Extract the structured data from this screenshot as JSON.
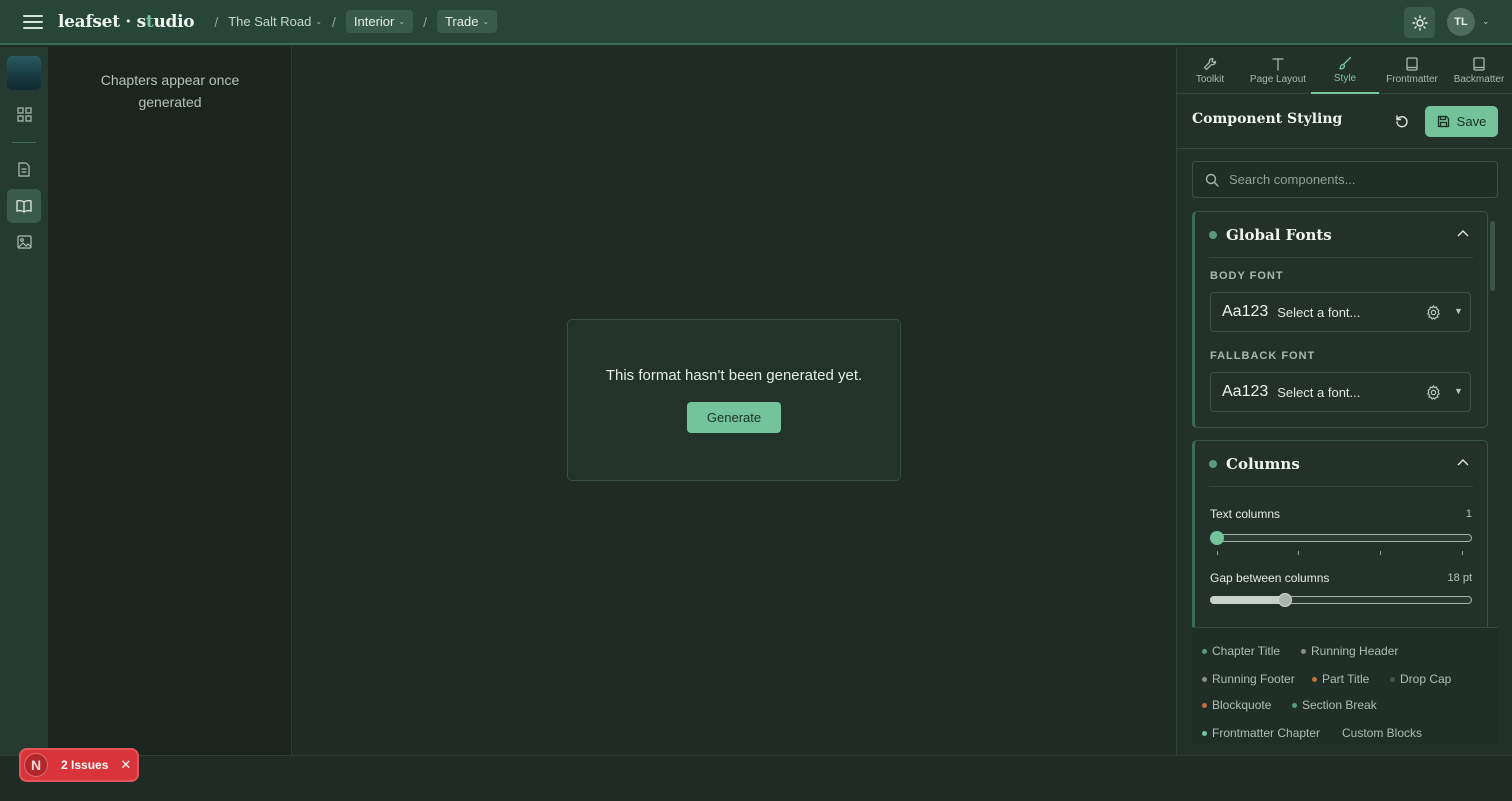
{
  "app": {
    "logo_main": "leafset",
    "logo_mid": "·",
    "logo_s": "s",
    "logo_t": "t",
    "logo_rest": "udio"
  },
  "breadcrumb": {
    "separator": "/",
    "project": "The Salt Road",
    "format": "Interior",
    "trim": "Trade"
  },
  "user": {
    "initials": "TL"
  },
  "chapters": {
    "empty_text": "Chapters appear once generated"
  },
  "canvas": {
    "notice_text": "This format hasn't been generated yet.",
    "generate_label": "Generate"
  },
  "issues": {
    "badge_letter": "N",
    "label": "2 Issues"
  },
  "panel": {
    "tabs": [
      {
        "label": "Toolkit",
        "icon": "wrench-icon",
        "active": false
      },
      {
        "label": "Page Layout",
        "icon": "text-t-icon",
        "active": false
      },
      {
        "label": "Style",
        "icon": "paintbrush-icon",
        "active": true
      },
      {
        "label": "Frontmatter",
        "icon": "book-icon",
        "active": false
      },
      {
        "label": "Backmatter",
        "icon": "book-icon",
        "active": false
      }
    ],
    "title": "Component Styling",
    "save_label": "Save",
    "search_placeholder": "Search components...",
    "global_fonts": {
      "title": "Global Fonts",
      "body_label": "BODY FONT",
      "body_sample": "Aa123",
      "body_value": "Select a font...",
      "fallback_label": "FALLBACK FONT",
      "fallback_sample": "Aa123",
      "fallback_value": "Select a font..."
    },
    "columns": {
      "title": "Columns",
      "text_columns_label": "Text columns",
      "text_columns_value": "1",
      "text_columns_fraction": 0,
      "gap_label": "Gap between columns",
      "gap_value": "18 pt",
      "gap_fraction": 0.29
    },
    "components": [
      {
        "label": "Chapter Title",
        "color": "#5a9a7a"
      },
      {
        "label": "Running Header",
        "color": "#8a8f8c"
      },
      {
        "label": "Running Footer",
        "color": "#8a8f8c"
      },
      {
        "label": "Part Title",
        "color": "#c0703a"
      },
      {
        "label": "Drop Cap",
        "color": "#3e5a4c"
      },
      {
        "label": "Blockquote",
        "color": "#c0703a"
      },
      {
        "label": "Section Break",
        "color": "#5a9a7a"
      },
      {
        "label": "Frontmatter Chapter",
        "color": "#74c39b"
      },
      {
        "label": "Custom Blocks",
        "color": ""
      }
    ]
  },
  "colors": {
    "accent": "#74c39b",
    "danger": "#d8343a",
    "topbar": "#28453a"
  }
}
